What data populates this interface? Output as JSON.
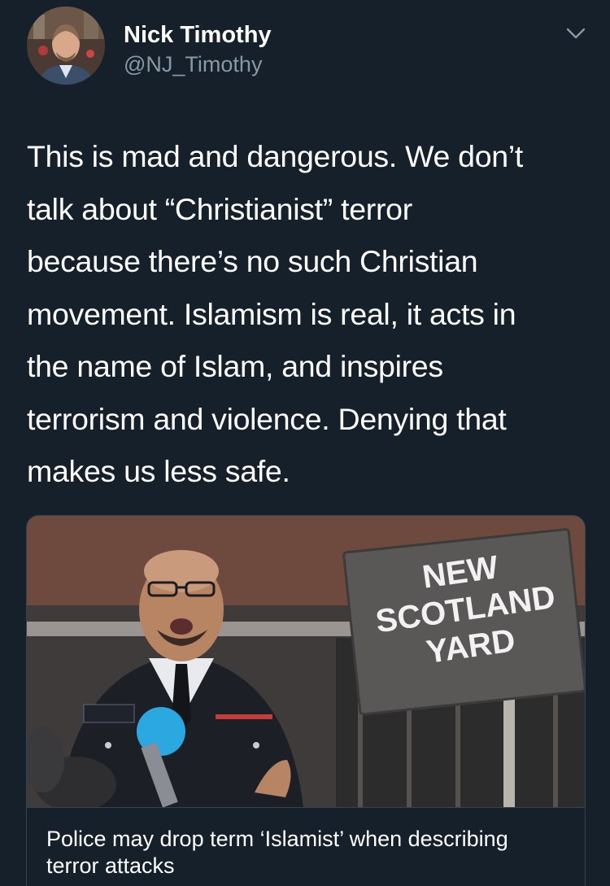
{
  "author": {
    "name": "Nick Timothy",
    "handle": "@NJ_Timothy"
  },
  "tweet": {
    "lines": [
      "This is mad and dangerous. We don’t",
      "talk about “Christianist” terror",
      "because there’s no such Christian",
      "movement. Islamism is real, it acts in",
      "the name of Islam, and inspires",
      "terrorism and violence. Denying that",
      "makes us less safe."
    ]
  },
  "card": {
    "image_sign_text": [
      "NEW",
      "SCOTLAND",
      "YARD"
    ],
    "title": "Police may drop term ‘Islamist’ when describing terror attacks"
  },
  "icons": {
    "menu": "chevron-down-icon"
  },
  "colors": {
    "background": "#15202b",
    "text_primary": "#ffffff",
    "text_secondary": "#8899a6",
    "border": "#38444d"
  }
}
